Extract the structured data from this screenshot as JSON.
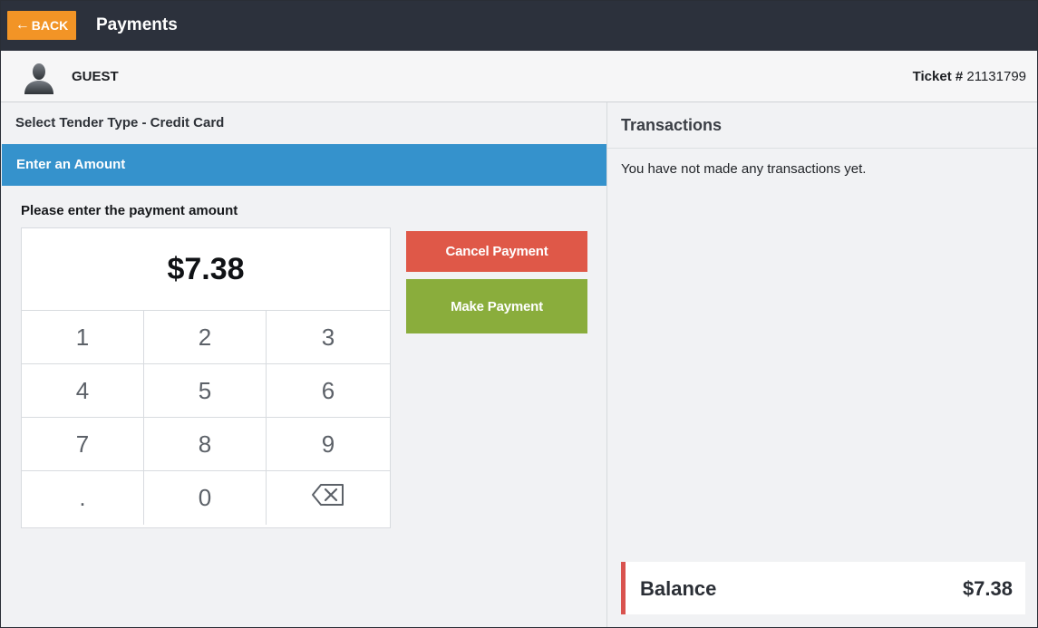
{
  "header": {
    "back_label": "BACK",
    "title": "Payments"
  },
  "guest": {
    "name": "GUEST",
    "ticket_label": "Ticket #",
    "ticket_number": "21131799"
  },
  "payment": {
    "tender_label": "Select Tender Type - Credit Card",
    "section_title": "Enter an Amount",
    "prompt": "Please enter the payment amount",
    "amount": "$7.38",
    "keys": [
      "1",
      "2",
      "3",
      "4",
      "5",
      "6",
      "7",
      "8",
      "9",
      ".",
      "0",
      "backspace"
    ],
    "cancel_label": "Cancel Payment",
    "make_label": "Make Payment"
  },
  "transactions": {
    "title": "Transactions",
    "empty_message": "You have not made any transactions yet.",
    "balance_label": "Balance",
    "balance_value": "$7.38"
  },
  "colors": {
    "topbar": "#2c313c",
    "back_button": "#f29426",
    "section_bar": "#3592cc",
    "cancel": "#df5848",
    "make": "#8aad3c",
    "balance_accent": "#d9534f"
  },
  "icons": {
    "back": "arrow-left-icon",
    "avatar": "person-icon",
    "backspace": "backspace-icon"
  }
}
